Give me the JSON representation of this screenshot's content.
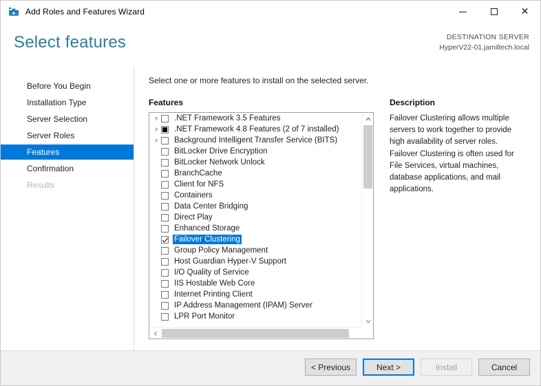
{
  "window": {
    "title": "Add Roles and Features Wizard",
    "icon": "server-manager-icon",
    "minimize_label": "Minimize",
    "maximize_label": "Maximize",
    "close_label": "Close"
  },
  "header": {
    "page_title": "Select features",
    "destination_label": "DESTINATION SERVER",
    "destination_server": "HyperV22-01.jamiltech.local"
  },
  "sidebar": {
    "items": [
      {
        "label": "Before You Begin",
        "state": "normal"
      },
      {
        "label": "Installation Type",
        "state": "normal"
      },
      {
        "label": "Server Selection",
        "state": "normal"
      },
      {
        "label": "Server Roles",
        "state": "normal"
      },
      {
        "label": "Features",
        "state": "active"
      },
      {
        "label": "Confirmation",
        "state": "normal"
      },
      {
        "label": "Results",
        "state": "disabled"
      }
    ]
  },
  "content": {
    "instruction": "Select one or more features to install on the selected server.",
    "features_heading": "Features",
    "description_heading": "Description",
    "description_text": "Failover Clustering allows multiple servers to work together to provide high availability of server roles. Failover Clustering is often used for File Services, virtual machines, database applications, and mail applications.",
    "features": [
      {
        "label": ".NET Framework 3.5 Features",
        "checkbox": "unchecked",
        "expandable": true,
        "selected": false
      },
      {
        "label": ".NET Framework 4.8 Features (2 of 7 installed)",
        "checkbox": "partial",
        "expandable": true,
        "selected": false
      },
      {
        "label": "Background Intelligent Transfer Service (BITS)",
        "checkbox": "unchecked",
        "expandable": true,
        "selected": false
      },
      {
        "label": "BitLocker Drive Encryption",
        "checkbox": "unchecked",
        "expandable": false,
        "selected": false
      },
      {
        "label": "BitLocker Network Unlock",
        "checkbox": "unchecked",
        "expandable": false,
        "selected": false
      },
      {
        "label": "BranchCache",
        "checkbox": "unchecked",
        "expandable": false,
        "selected": false
      },
      {
        "label": "Client for NFS",
        "checkbox": "unchecked",
        "expandable": false,
        "selected": false
      },
      {
        "label": "Containers",
        "checkbox": "unchecked",
        "expandable": false,
        "selected": false
      },
      {
        "label": "Data Center Bridging",
        "checkbox": "unchecked",
        "expandable": false,
        "selected": false
      },
      {
        "label": "Direct Play",
        "checkbox": "unchecked",
        "expandable": false,
        "selected": false
      },
      {
        "label": "Enhanced Storage",
        "checkbox": "unchecked",
        "expandable": false,
        "selected": false
      },
      {
        "label": "Failover Clustering",
        "checkbox": "checked",
        "expandable": false,
        "selected": true
      },
      {
        "label": "Group Policy Management",
        "checkbox": "unchecked",
        "expandable": false,
        "selected": false
      },
      {
        "label": "Host Guardian Hyper-V Support",
        "checkbox": "unchecked",
        "expandable": false,
        "selected": false
      },
      {
        "label": "I/O Quality of Service",
        "checkbox": "unchecked",
        "expandable": false,
        "selected": false
      },
      {
        "label": "IIS Hostable Web Core",
        "checkbox": "unchecked",
        "expandable": false,
        "selected": false
      },
      {
        "label": "Internet Printing Client",
        "checkbox": "unchecked",
        "expandable": false,
        "selected": false
      },
      {
        "label": "IP Address Management (IPAM) Server",
        "checkbox": "unchecked",
        "expandable": false,
        "selected": false
      },
      {
        "label": "LPR Port Monitor",
        "checkbox": "unchecked",
        "expandable": false,
        "selected": false
      }
    ],
    "scrollbars": {
      "vertical_up_icon": "chevron-up-icon",
      "vertical_down_icon": "chevron-down-icon",
      "horizontal_left_icon": "chevron-left-icon",
      "horizontal_right_icon": "chevron-right-icon"
    }
  },
  "footer": {
    "previous_label": "< Previous",
    "next_label": "Next >",
    "install_label": "Install",
    "cancel_label": "Cancel"
  },
  "colors": {
    "accent": "#0078d7",
    "title_accent": "#2e7d9e",
    "footer_bg": "#f0f0f0"
  }
}
